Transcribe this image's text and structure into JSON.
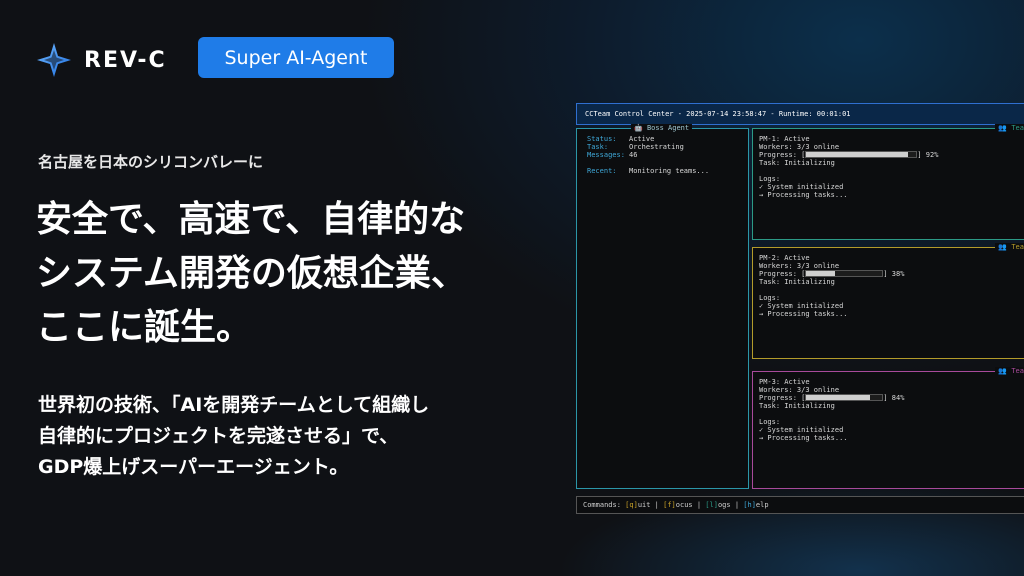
{
  "brand": {
    "logo_text": "REV-C",
    "badge": "Super AI-Agent",
    "accent": "#1f7ce8"
  },
  "hero": {
    "tagline": "名古屋を日本のシリコンバレーに",
    "headline": [
      "安全で、高速で、自律的な",
      "システム開発の仮想企業、",
      "ここに誕生。"
    ],
    "body": [
      "世界初の技術、「AIを開発チームとして組織し",
      "自律的にプロジェクトを完遂させる」で、",
      "GDP爆上げスーパーエージェント。"
    ]
  },
  "terminal": {
    "title": "CCTeam Control Center - 2025-07-14 23:58:47 - Runtime: 00:01:01",
    "boss": {
      "title": "Boss Agent",
      "icon": "robot-icon",
      "fields": [
        {
          "key": "Status:",
          "value": "Active"
        },
        {
          "key": "Task:",
          "value": "Orchestrating"
        },
        {
          "key": "Messages:",
          "value": "46"
        }
      ],
      "recent_key": "Recent:",
      "recent_value": "Monitoring teams..."
    },
    "teams": [
      {
        "title": "Tea",
        "icon": "team-icon",
        "name_line": "PM-1: Active",
        "workers": "Workers: 3/3 online",
        "progress_label": "Progress: [",
        "progress": 92,
        "progress_text": "] 92%",
        "task": "Task: Initializing",
        "logs_label": "Logs:",
        "logs": [
          "✓ System initialized",
          "→ Processing tasks..."
        ],
        "color": "#2c9a86"
      },
      {
        "title": "Tea",
        "icon": "team-icon",
        "name_line": "PM-2: Active",
        "workers": "Workers: 3/3 online",
        "progress_label": "Progress: [",
        "progress": 38,
        "progress_text": "] 38%",
        "task": "Task: Initializing",
        "logs_label": "Logs:",
        "logs": [
          "✓ System initialized",
          "→ Processing tasks..."
        ],
        "color": "#b39b2a"
      },
      {
        "title": "Tea",
        "icon": "team-icon",
        "name_line": "PM-3: Active",
        "workers": "Workers: 3/3 online",
        "progress_label": "Progress: [",
        "progress": 84,
        "progress_text": "] 84%",
        "task": "Task: Initializing",
        "logs_label": "Logs:",
        "logs": [
          "✓ System initialized",
          "→ Processing tasks..."
        ],
        "color": "#a84a9a"
      }
    ],
    "commands": {
      "label": "Commands:",
      "items": [
        {
          "key": "[q]",
          "rest": "uit"
        },
        {
          "key": "[f]",
          "rest": "ocus"
        },
        {
          "key": "[l]",
          "rest": "ogs"
        },
        {
          "key": "[h]",
          "rest": "elp"
        }
      ],
      "separator": " | "
    }
  }
}
